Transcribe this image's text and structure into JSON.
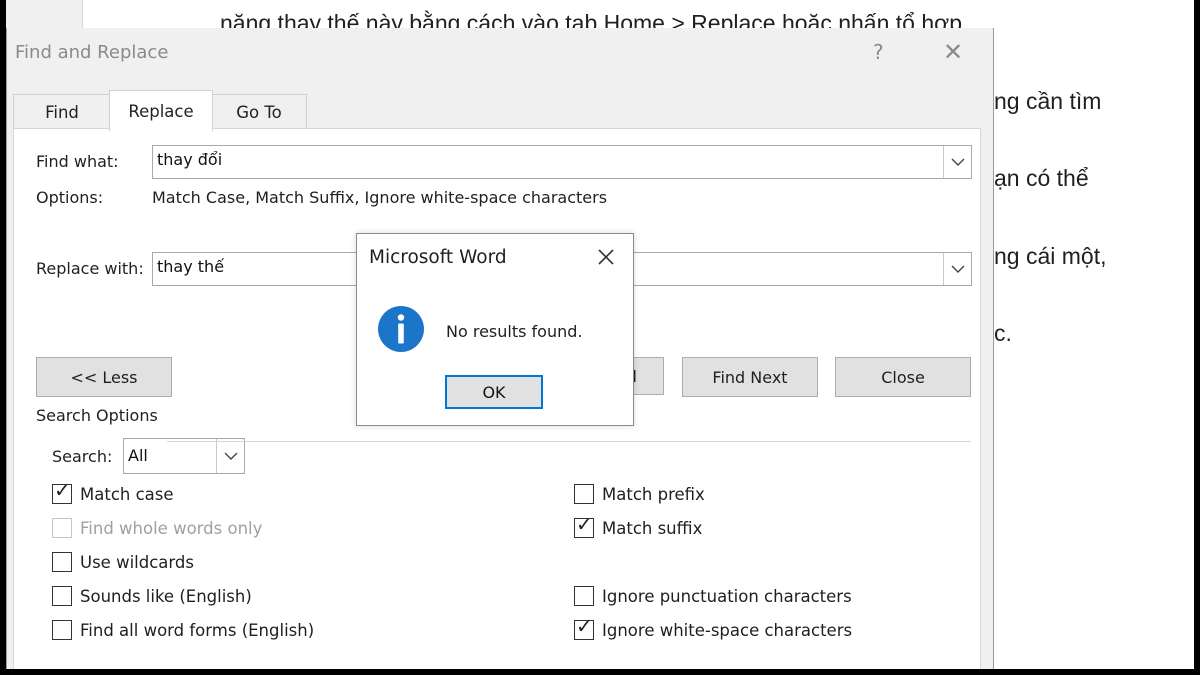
{
  "document": {
    "lines": [
      "năng thay thế này bằng cách vào tab Home > Replace hoặc nhấn tổ hợp",
      "ng cần tìm",
      "ạn có thể",
      "ng cái một,",
      "c."
    ]
  },
  "dialog": {
    "title": "Find and Replace",
    "help_label": "?",
    "close_label": "✕",
    "tabs": [
      {
        "label": "Find",
        "active": false
      },
      {
        "label": "Replace",
        "active": true
      },
      {
        "label": "Go To",
        "active": false
      }
    ],
    "find_what": {
      "label": "Find what:",
      "value": "thay đổi"
    },
    "options": {
      "label": "Options:",
      "value": "Match Case, Match Suffix, Ignore white-space characters"
    },
    "replace_with": {
      "label": "Replace with:",
      "value": "thay thế"
    },
    "buttons": {
      "less": "<< Less",
      "replace_all_partial": "l",
      "find_next": "Find Next",
      "close": "Close"
    },
    "search_options": {
      "heading": "Search Options",
      "search_label": "Search:",
      "search_value": "All",
      "left": [
        {
          "label": "Match case",
          "checked": true,
          "disabled": false
        },
        {
          "label": "Find whole words only",
          "checked": false,
          "disabled": true
        },
        {
          "label": "Use wildcards",
          "checked": false,
          "disabled": false
        },
        {
          "label": "Sounds like (English)",
          "checked": false,
          "disabled": false
        },
        {
          "label": "Find all word forms (English)",
          "checked": false,
          "disabled": false
        }
      ],
      "right": [
        {
          "label": "Match prefix",
          "checked": false,
          "disabled": false
        },
        {
          "label": "Match suffix",
          "checked": true,
          "disabled": false
        },
        {
          "label": "Ignore punctuation characters",
          "checked": false,
          "disabled": false
        },
        {
          "label": "Ignore white-space characters",
          "checked": true,
          "disabled": false
        }
      ]
    }
  },
  "message_box": {
    "title": "Microsoft Word",
    "icon": "info-icon",
    "text": "No results found.",
    "ok_label": "OK"
  },
  "colors": {
    "accent": "#0078d7",
    "info_icon": "#1b75c9"
  }
}
